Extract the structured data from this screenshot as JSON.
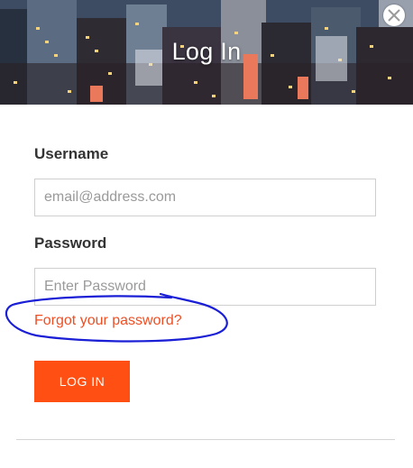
{
  "modal": {
    "title": "Log In",
    "close_icon": "close-icon"
  },
  "form": {
    "username_label": "Username",
    "username_placeholder": "email@address.com",
    "username_value": "",
    "password_label": "Password",
    "password_placeholder": "Enter Password",
    "password_value": "",
    "forgot_link": "Forgot your password?",
    "submit_label": "LOG IN"
  },
  "colors": {
    "accent": "#ff4f12",
    "link": "#f04e23",
    "annotation": "#1a1fd6"
  }
}
